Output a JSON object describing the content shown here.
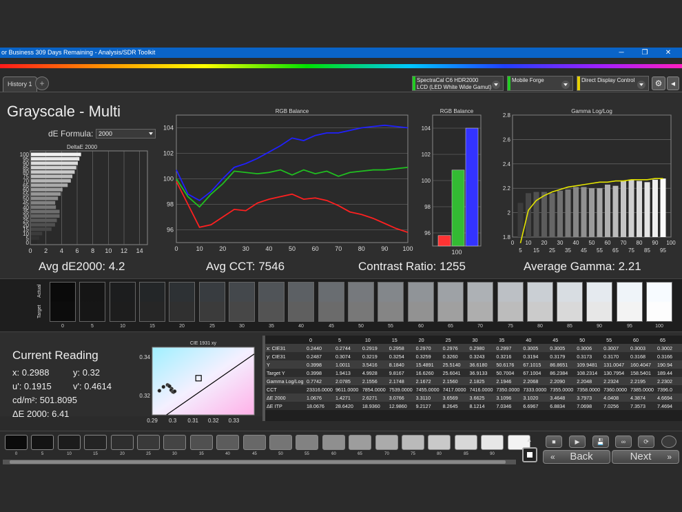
{
  "window": {
    "title": "or Business 309 Days Remaining  - Analysis/SDR Toolkit",
    "minimize": "─",
    "restore": "❐",
    "close": "✕"
  },
  "toolbar": {
    "tab_history": "History 1",
    "tab_add": "+",
    "meter_line1": "SpectraCal C6 HDR2000",
    "meter_line2": "LCD (LED White Wide Gamut)",
    "meter_color": "#22cc22",
    "pattern_gen": "Mobile Forge",
    "pattern_color": "#22cc22",
    "display_control": "Direct Display Control",
    "display_color": "#e6d000",
    "gear": "⚙",
    "collapse": "◂"
  },
  "page_title": "Grayscale - Multi",
  "de_formula": {
    "label": "dE Formula:",
    "value": "2000"
  },
  "summary": {
    "avg_de": "Avg dE2000: 4.2",
    "avg_cct": "Avg CCT: 7546",
    "contrast": "Contrast Ratio: 1255",
    "avg_gamma": "Average Gamma: 2.21"
  },
  "chart_data": [
    {
      "type": "bar",
      "title": "DeltaE 2000",
      "orientation": "horizontal",
      "categories": [
        "0",
        "5",
        "10",
        "15",
        "20",
        "25",
        "30",
        "35",
        "40",
        "45",
        "50",
        "55",
        "60",
        "65",
        "70",
        "75",
        "80",
        "85",
        "90",
        "95",
        "100"
      ],
      "values": [
        0.77,
        1.07,
        1.43,
        2.63,
        3.08,
        3.31,
        3.66,
        3.66,
        3.19,
        3.1,
        3.46,
        3.8,
        4.04,
        4.7,
        5.1,
        5.3,
        5.6,
        5.8,
        6.0,
        6.2,
        6.41
      ],
      "xlim": [
        0,
        15
      ],
      "xticks": [
        "0",
        "2",
        "4",
        "6",
        "8",
        "10",
        "12",
        "14"
      ],
      "yticks": [
        "0",
        "5",
        "10",
        "15",
        "20",
        "25",
        "30",
        "35",
        "40",
        "45",
        "50",
        "55",
        "60",
        "65",
        "70",
        "75",
        "80",
        "85",
        "90",
        "95",
        "100"
      ]
    },
    {
      "type": "line",
      "title": "RGB Balance",
      "x": [
        0,
        5,
        10,
        15,
        20,
        25,
        30,
        35,
        40,
        45,
        50,
        55,
        60,
        65,
        70,
        75,
        80,
        85,
        90,
        95,
        100
      ],
      "series": [
        {
          "color": "#ff2020",
          "values": [
            99.8,
            98.0,
            96.2,
            96.4,
            97.0,
            97.6,
            97.5,
            98.1,
            98.4,
            98.6,
            98.8,
            98.4,
            98.5,
            98.3,
            97.9,
            97.4,
            97.2,
            96.9,
            96.5,
            96.1,
            95.8
          ]
        },
        {
          "color": "#20c020",
          "values": [
            100.0,
            98.6,
            97.8,
            98.8,
            99.6,
            100.6,
            100.5,
            100.4,
            100.5,
            100.7,
            100.3,
            100.7,
            100.4,
            100.6,
            100.2,
            100.5,
            100.6,
            100.7,
            100.7,
            100.8,
            100.9
          ]
        },
        {
          "color": "#2020ff",
          "values": [
            100.7,
            98.8,
            98.3,
            99.0,
            100.0,
            100.9,
            101.2,
            101.6,
            102.1,
            102.6,
            103.2,
            103.0,
            103.4,
            103.6,
            103.6,
            103.8,
            104.0,
            104.1,
            104.2,
            104.1,
            104.0
          ]
        }
      ],
      "xlim": [
        0,
        100
      ],
      "ylim": [
        95,
        105
      ],
      "yticks": [
        "96",
        "98",
        "100",
        "102",
        "104"
      ],
      "xticks": [
        "0",
        "10",
        "20",
        "30",
        "40",
        "50",
        "60",
        "70",
        "80",
        "90",
        "100"
      ]
    },
    {
      "type": "bar",
      "title": "RGB Balance",
      "categories": [
        "100"
      ],
      "series": [
        {
          "color": "#ff3333",
          "values": [
            95.8
          ]
        },
        {
          "color": "#33bb33",
          "values": [
            100.8
          ]
        },
        {
          "color": "#3333ff",
          "values": [
            104.0
          ]
        }
      ],
      "ylim": [
        95,
        105
      ],
      "yticks": [
        "96",
        "98",
        "100",
        "102",
        "104"
      ]
    },
    {
      "type": "bar",
      "title": "Gamma Log/Log",
      "categories": [
        "5",
        "10",
        "15",
        "20",
        "25",
        "30",
        "35",
        "40",
        "45",
        "50",
        "55",
        "60",
        "65",
        "70",
        "75",
        "80",
        "85",
        "90",
        "95"
      ],
      "values": [
        2.08,
        2.16,
        2.17,
        2.17,
        2.16,
        2.18,
        2.19,
        2.21,
        2.21,
        2.2,
        2.2,
        2.23,
        2.22,
        2.26,
        2.27,
        2.26,
        2.25,
        2.27,
        2.28
      ],
      "target_curve": [
        1.75,
        2.02,
        2.1,
        2.14,
        2.17,
        2.19,
        2.21,
        2.22,
        2.23,
        2.24,
        2.25,
        2.25,
        2.26,
        2.26,
        2.27,
        2.27,
        2.27,
        2.28,
        2.28
      ],
      "target_color": "#e6e600",
      "ylim": [
        1.8,
        2.8
      ],
      "yticks": [
        "1.8",
        "2",
        "2.2",
        "2.4",
        "2.6",
        "2.8"
      ],
      "xticks_top": [
        "0",
        "10",
        "20",
        "30",
        "40",
        "50",
        "60",
        "70",
        "80",
        "90",
        "100"
      ],
      "xticks_bottom": [
        "5",
        "15",
        "25",
        "35",
        "45",
        "55",
        "65",
        "75",
        "85",
        "95"
      ]
    },
    {
      "type": "scatter",
      "title": "CIE 1931 xy",
      "xlim": [
        0.29,
        0.34
      ],
      "ylim": [
        0.31,
        0.345
      ],
      "xticks": [
        "0.29",
        "0.3",
        "0.31",
        "0.32",
        "0.33"
      ],
      "yticks": [
        "0.32",
        "0.34"
      ],
      "points": [
        [
          0.2955,
          0.3245
        ],
        [
          0.2975,
          0.3255
        ],
        [
          0.298,
          0.3252
        ],
        [
          0.2985,
          0.3248
        ],
        [
          0.2995,
          0.3235
        ],
        [
          0.2993,
          0.3228
        ],
        [
          0.3,
          0.322
        ],
        [
          0.3005,
          0.3218
        ],
        [
          0.301,
          0.3222
        ],
        [
          0.2935,
          0.3225
        ]
      ],
      "target": [
        0.3127,
        0.329
      ]
    }
  ],
  "swatches": {
    "actual_label": "Actual",
    "target_label": "Target",
    "items": [
      {
        "label": "0",
        "actual": "#0a0a0a",
        "target": "#0c0c0c"
      },
      {
        "label": "5",
        "actual": "#151515",
        "target": "#161616"
      },
      {
        "label": "10",
        "actual": "#1c1d1e",
        "target": "#1d1d1d"
      },
      {
        "label": "15",
        "actual": "#232628",
        "target": "#262626"
      },
      {
        "label": "20",
        "actual": "#2d3134",
        "target": "#303030"
      },
      {
        "label": "25",
        "actual": "#383c40",
        "target": "#3b3b3b"
      },
      {
        "label": "30",
        "actual": "#44484c",
        "target": "#474747"
      },
      {
        "label": "35",
        "actual": "#505458",
        "target": "#535353"
      },
      {
        "label": "40",
        "actual": "#5c6064",
        "target": "#5f5f5f"
      },
      {
        "label": "45",
        "actual": "#696d71",
        "target": "#6b6b6b"
      },
      {
        "label": "50",
        "actual": "#76797d",
        "target": "#787878"
      },
      {
        "label": "55",
        "actual": "#83878b",
        "target": "#858585"
      },
      {
        "label": "60",
        "actual": "#909498",
        "target": "#929292"
      },
      {
        "label": "65",
        "actual": "#9ea2a6",
        "target": "#a0a0a0"
      },
      {
        "label": "70",
        "actual": "#adb1b5",
        "target": "#aeaeae"
      },
      {
        "label": "75",
        "actual": "#bcc0c5",
        "target": "#bcbcbc"
      },
      {
        "label": "80",
        "actual": "#cacfd4",
        "target": "#cbcbcb"
      },
      {
        "label": "85",
        "actual": "#d8dde2",
        "target": "#d9d9d9"
      },
      {
        "label": "90",
        "actual": "#e5eaef",
        "target": "#e7e7e7"
      },
      {
        "label": "95",
        "actual": "#eff4f9",
        "target": "#f3f3f3"
      },
      {
        "label": "100",
        "actual": "#f7fbff",
        "target": "#fdfdfd"
      }
    ]
  },
  "current_reading": {
    "title": "Current Reading",
    "x": "x: 0.2988",
    "y": "y: 0.32",
    "u": "u': 0.1915",
    "v": "v': 0.4614",
    "cdm2": "cd/m²: 501.8095",
    "de": "ΔE 2000: 6.41"
  },
  "table": {
    "headers": [
      "",
      "0",
      "5",
      "10",
      "15",
      "20",
      "25",
      "30",
      "35",
      "40",
      "45",
      "50",
      "55",
      "60",
      "65"
    ],
    "rows": [
      [
        "x: CIE31",
        "0.2440",
        "0.2744",
        "0.2919",
        "0.2958",
        "0.2970",
        "0.2976",
        "0.2980",
        "0.2997",
        "0.3005",
        "0.3005",
        "0.3006",
        "0.3007",
        "0.3003",
        "0.3002"
      ],
      [
        "y: CIE31",
        "0.2487",
        "0.3074",
        "0.3219",
        "0.3254",
        "0.3259",
        "0.3260",
        "0.3243",
        "0.3216",
        "0.3194",
        "0.3179",
        "0.3173",
        "0.3170",
        "0.3168",
        "0.3166"
      ],
      [
        "Y",
        "0.3998",
        "1.0011",
        "3.5416",
        "8.1840",
        "15.4891",
        "25.5140",
        "36.6180",
        "50.6176",
        "67.1015",
        "86.8651",
        "109.9481",
        "131.0047",
        "160.4047",
        "190.94"
      ],
      [
        "Target Y",
        "0.3998",
        "1.9413",
        "4.9928",
        "9.8167",
        "16.6260",
        "25.6041",
        "36.9133",
        "50.7004",
        "67.1004",
        "86.2384",
        "108.2314",
        "130.7954",
        "158.5401",
        "189.44"
      ],
      [
        "Gamma Log/Log",
        "0.7742",
        "2.0785",
        "2.1556",
        "2.1748",
        "2.1672",
        "2.1560",
        "2.1825",
        "2.1946",
        "2.2068",
        "2.2090",
        "2.2048",
        "2.2324",
        "2.2195",
        "2.2302"
      ],
      [
        "CCT",
        "23316.0000",
        "9611.0000",
        "7854.0000",
        "7539.0000",
        "7455.0000",
        "7417.0000",
        "7416.0000",
        "7350.0000",
        "7333.0000",
        "7355.0000",
        "7358.0000",
        "7360.0000",
        "7385.0000",
        "7396.0"
      ],
      [
        "ΔE 2000",
        "1.0676",
        "1.4271",
        "2.6271",
        "3.0766",
        "3.3110",
        "3.6569",
        "3.6625",
        "3.1096",
        "3.1020",
        "3.4648",
        "3.7973",
        "4.0408",
        "4.3874",
        "4.6694"
      ],
      [
        "ΔE ITP",
        "18.0676",
        "28.6420",
        "18.9360",
        "12.9860",
        "9.2127",
        "8.2645",
        "8.1214",
        "7.0346",
        "6.6967",
        "6.8834",
        "7.0698",
        "7.0256",
        "7.3573",
        "7.4694"
      ]
    ]
  },
  "bottom_patches": {
    "items": [
      {
        "label": "0",
        "color": "#0b0b0b"
      },
      {
        "label": "5",
        "color": "#141414"
      },
      {
        "label": "10",
        "color": "#1c1c1c"
      },
      {
        "label": "15",
        "color": "#242424"
      },
      {
        "label": "20",
        "color": "#2e2e2e"
      },
      {
        "label": "25",
        "color": "#393939"
      },
      {
        "label": "30",
        "color": "#444444"
      },
      {
        "label": "35",
        "color": "#505050"
      },
      {
        "label": "40",
        "color": "#5c5c5c"
      },
      {
        "label": "45",
        "color": "#686868"
      },
      {
        "label": "50",
        "color": "#757575"
      },
      {
        "label": "55",
        "color": "#828282"
      },
      {
        "label": "60",
        "color": "#8f8f8f"
      },
      {
        "label": "65",
        "color": "#9d9d9d"
      },
      {
        "label": "70",
        "color": "#ababab"
      },
      {
        "label": "75",
        "color": "#bababa"
      },
      {
        "label": "80",
        "color": "#c9c9c9"
      },
      {
        "label": "85",
        "color": "#d8d8d8"
      },
      {
        "label": "90",
        "color": "#e7e7e7"
      },
      {
        "label": "",
        "color": "#f3f3f3"
      }
    ]
  },
  "nav": {
    "back": "Back",
    "next": "Next",
    "back_icon": "«",
    "next_icon": "»",
    "up_icon": "▲",
    "stop_icon": "■",
    "play_icon": "▶",
    "save_icon": "💾",
    "loop_icon": "∞",
    "refresh_icon": "⟳"
  }
}
